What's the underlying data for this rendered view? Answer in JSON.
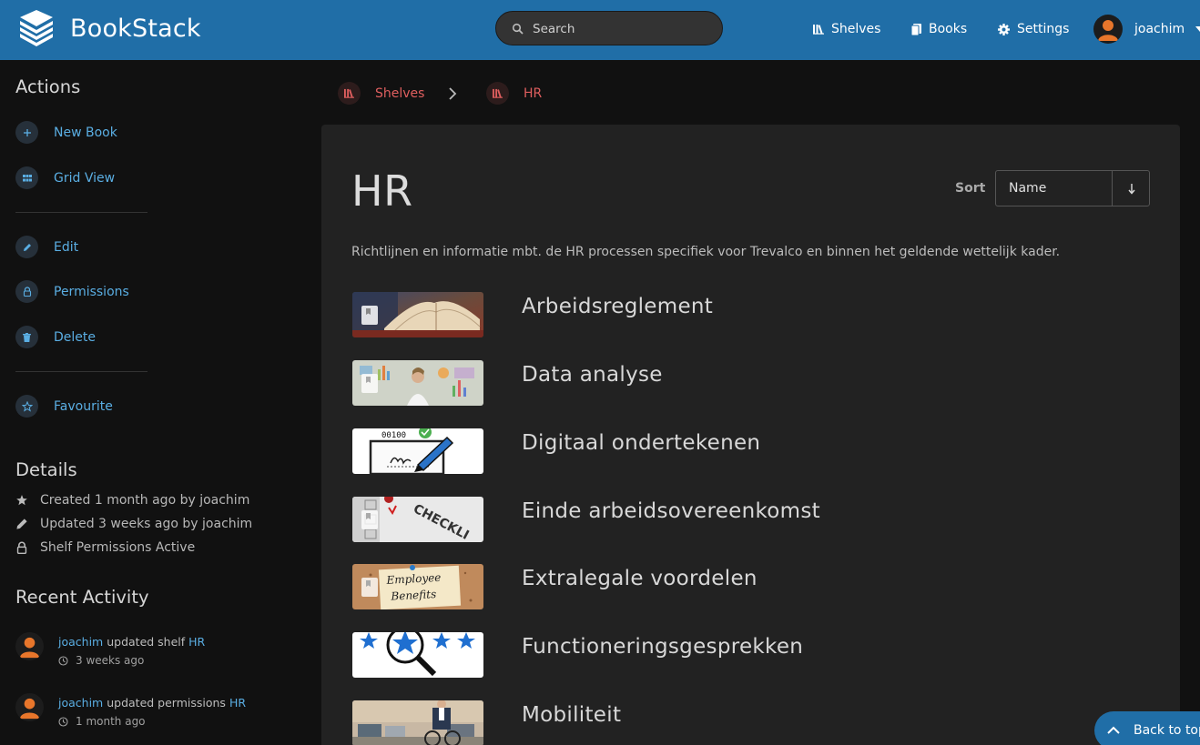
{
  "header": {
    "app_name": "BookStack",
    "search_placeholder": "Search",
    "nav": [
      {
        "label": "Shelves"
      },
      {
        "label": "Books"
      },
      {
        "label": "Settings"
      }
    ],
    "user_name": "joachim"
  },
  "sidebar": {
    "actions_heading": "Actions",
    "actions": [
      {
        "label": "New Book",
        "icon": "plus-icon"
      },
      {
        "label": "Grid View",
        "icon": "grid-icon"
      },
      {
        "label": "Edit",
        "icon": "pencil-icon"
      },
      {
        "label": "Permissions",
        "icon": "lock-icon"
      },
      {
        "label": "Delete",
        "icon": "trash-icon"
      },
      {
        "label": "Favourite",
        "icon": "star-icon"
      }
    ],
    "details_heading": "Details",
    "details": [
      {
        "text": "Created 1 month ago by joachim",
        "icon": "star-icon"
      },
      {
        "text": "Updated 3 weeks ago by joachim",
        "icon": "pencil-icon"
      },
      {
        "text": "Shelf Permissions Active",
        "icon": "lock-icon"
      }
    ],
    "activity_heading": "Recent Activity",
    "activity": [
      {
        "user": "joachim",
        "action": "updated shelf",
        "target": "HR",
        "time": "3 weeks ago"
      },
      {
        "user": "joachim",
        "action": "updated permissions",
        "target": "HR",
        "time": "1 month ago"
      }
    ]
  },
  "breadcrumb": [
    {
      "label": "Shelves"
    },
    {
      "label": "HR"
    }
  ],
  "main": {
    "title": "HR",
    "sort_label": "Sort",
    "sort_value": "Name",
    "description": "Richtlijnen en informatie mbt. de HR processen specifiek voor Trevalco en binnen het geldende wettelijk kader.",
    "books": [
      {
        "name": "Arbeidsreglement"
      },
      {
        "name": "Data analyse"
      },
      {
        "name": "Digitaal ondertekenen",
        "thumb_text": "00100"
      },
      {
        "name": "Einde arbeidsovereenkomst",
        "thumb_text": "CHECKLI"
      },
      {
        "name": "Extralegale voordelen",
        "thumb_text_1": "Employee",
        "thumb_text_2": "Benefits"
      },
      {
        "name": "Functioneringsgesprekken"
      },
      {
        "name": "Mobiliteit"
      }
    ]
  },
  "back_to_top": "Back to top",
  "colors": {
    "header": "#206ea7",
    "link": "#5aaee3",
    "breadcrumb": "#e05f5f",
    "avatar": "#e8762b"
  }
}
